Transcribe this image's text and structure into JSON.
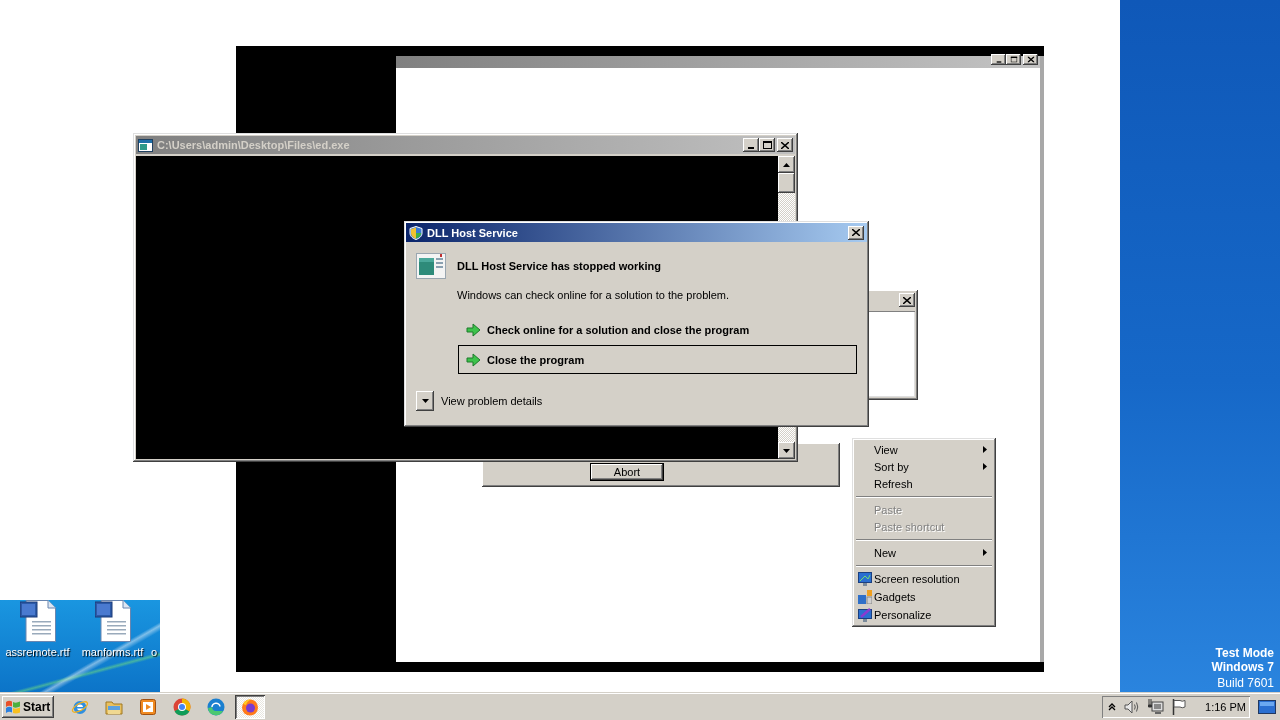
{
  "console_window": {
    "title": "C:\\Users\\admin\\Desktop\\Files\\ed.exe"
  },
  "background_dialog": {
    "button": "Abort"
  },
  "error_dialog": {
    "title": "DLL Host Service",
    "heading": "DLL Host Service has stopped working",
    "message": "Windows can check online for a solution to the problem.",
    "options": [
      {
        "label": "Check online for a solution and close the program",
        "selected": false
      },
      {
        "label": "Close the program",
        "selected": true
      }
    ],
    "details": {
      "label": "View problem details",
      "expanded": false
    }
  },
  "context_menu": {
    "items": [
      {
        "kind": "plain",
        "label": "View",
        "disabled": false,
        "submenu": true
      },
      {
        "kind": "plain",
        "label": "Sort by",
        "disabled": false,
        "submenu": true
      },
      {
        "kind": "plain",
        "label": "Refresh",
        "disabled": false,
        "submenu": false
      },
      {
        "kind": "separator"
      },
      {
        "kind": "plain",
        "label": "Paste",
        "disabled": true,
        "submenu": false
      },
      {
        "kind": "plain",
        "label": "Paste shortcut",
        "disabled": true,
        "submenu": false
      },
      {
        "kind": "separator"
      },
      {
        "kind": "plain",
        "label": "New",
        "disabled": false,
        "submenu": true
      },
      {
        "kind": "separator"
      },
      {
        "kind": "monitor",
        "label": "Screen resolution",
        "disabled": false,
        "submenu": false
      },
      {
        "kind": "tiles",
        "label": "Gadgets",
        "disabled": false,
        "submenu": false
      },
      {
        "kind": "brush",
        "label": "Personalize",
        "disabled": false,
        "submenu": false
      }
    ]
  },
  "desktop": {
    "icons": [
      {
        "label": "assremote.rtf"
      },
      {
        "label": "manforms.rtf"
      }
    ],
    "cut_label": "o"
  },
  "test_mode": {
    "mode": "Test Mode",
    "os": "Windows 7",
    "build": "Build 7601"
  },
  "taskbar": {
    "start": "Start",
    "apps": [
      {
        "kind": "globe",
        "selected": false
      },
      {
        "kind": "folder",
        "selected": false
      },
      {
        "kind": "player",
        "selected": false
      },
      {
        "kind": "segments",
        "selected": false
      },
      {
        "kind": "swirl",
        "selected": false
      },
      {
        "kind": "flame",
        "selected": true
      }
    ],
    "clock": "1:16 PM"
  }
}
